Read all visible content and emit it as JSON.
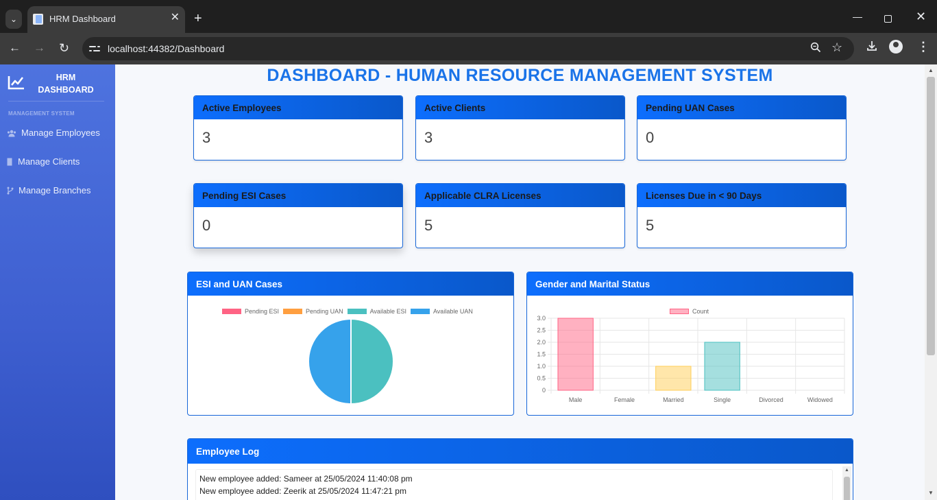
{
  "browser": {
    "tab_title": "HRM Dashboard",
    "tab_close_glyph": "✕",
    "new_tab_glyph": "+",
    "url": "localhost:44382/Dashboard"
  },
  "sidebar": {
    "brand": "HRM DASHBOARD",
    "heading": "MANAGEMENT SYSTEM",
    "items": [
      {
        "label": "Manage Employees",
        "icon": "users-icon"
      },
      {
        "label": "Manage Clients",
        "icon": "building-icon"
      },
      {
        "label": "Manage Branches",
        "icon": "branch-icon"
      }
    ]
  },
  "page": {
    "title": "DASHBOARD - HUMAN RESOURCE MANAGEMENT SYSTEM"
  },
  "cards": [
    {
      "title": "Active Employees",
      "value": "3"
    },
    {
      "title": "Active Clients",
      "value": "3"
    },
    {
      "title": "Pending UAN Cases",
      "value": "0"
    },
    {
      "title": "Pending ESI Cases",
      "value": "0"
    },
    {
      "title": "Applicable CLRA Licenses",
      "value": "5"
    },
    {
      "title": "Licenses Due in < 90 Days",
      "value": "5"
    }
  ],
  "esi_chart_title": "ESI and UAN Cases",
  "gender_chart_title": "Gender and Marital Status",
  "chart_data": [
    {
      "type": "pie",
      "legend_position": "top",
      "labels": [
        "Pending ESI",
        "Pending UAN",
        "Available ESI",
        "Available UAN"
      ],
      "values": [
        0,
        0,
        3,
        3
      ],
      "colors": [
        "#ff6384",
        "#ff9f40",
        "#4bc0c0",
        "#36a2eb"
      ]
    },
    {
      "type": "bar",
      "legend_position": "top",
      "categories": [
        "Male",
        "Female",
        "Married",
        "Single",
        "Divorced",
        "Widowed"
      ],
      "series": [
        {
          "name": "Count",
          "values": [
            3,
            0,
            1,
            2,
            0,
            0
          ]
        }
      ],
      "bar_fill": [
        "rgba(255,99,132,0.5)",
        "rgba(54,162,235,0.5)",
        "rgba(255,206,86,0.5)",
        "rgba(75,192,192,0.5)",
        "rgba(153,102,255,0.5)",
        "rgba(255,159,64,0.5)"
      ],
      "bar_border": [
        "#ff6384",
        "#36a2eb",
        "#ffce56",
        "#4bc0c0",
        "#9966ff",
        "#ff9f40"
      ],
      "ylim": [
        0,
        3
      ],
      "y_ticks": [
        "0",
        "0.5",
        "1.0",
        "1.5",
        "2.0",
        "2.5",
        "3.0"
      ],
      "grid": true
    }
  ],
  "employee_log": {
    "title": "Employee Log",
    "entries": [
      "New employee added: Sameer at 25/05/2024 11:40:08 pm",
      "New employee added: Zeerik at 25/05/2024 11:47:21 pm"
    ]
  }
}
